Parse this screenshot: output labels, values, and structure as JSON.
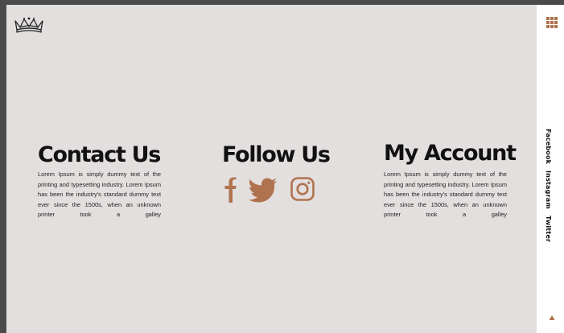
{
  "brand": {
    "logo_icon": "crown-icon",
    "menu_icon": "grid-menu-icon"
  },
  "contact": {
    "title": "Contact Us",
    "text": "Lorem Ipsum is simply dummy text of the printing and typesetting industry. Lorem Ipsum has been the industry's standard dummy text ever since the 1500s, when an unknown printer took a galley"
  },
  "follow": {
    "title": "Follow Us",
    "icons": [
      "facebook-icon",
      "twitter-icon",
      "instagram-icon"
    ]
  },
  "account": {
    "title": "My Account",
    "text": "Lorem Ipsum is simply dummy text of the printing and typesetting industry. Lorem Ipsum has been the industry's standard dummy text ever since the 1500s, when an unknown printer took a galley"
  },
  "side_links": [
    "Facebook",
    "Instagram",
    "Twitter"
  ],
  "colors": {
    "accent": "#b0734f",
    "panel": "#e3dfdf",
    "frame": "#4a4a4a"
  }
}
